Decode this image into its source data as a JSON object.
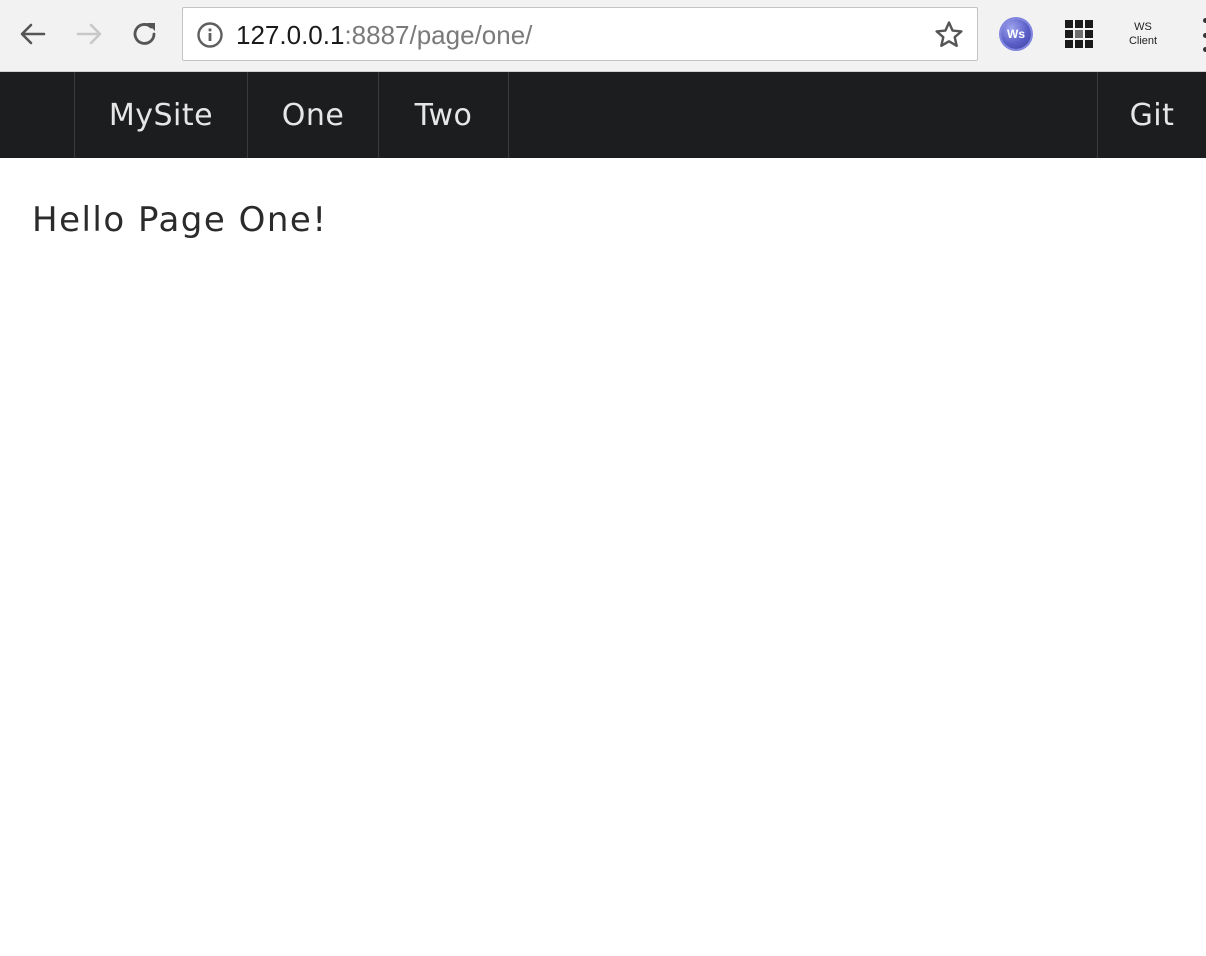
{
  "browser": {
    "url": {
      "host": "127.0.0.1",
      "rest": ":8887/page/one/"
    },
    "extensions": {
      "ws_badge_label": "Ws",
      "ws_client_line1": "WS",
      "ws_client_line2": "Client"
    }
  },
  "navbar": {
    "brand": "MySite",
    "links": [
      "One",
      "Two"
    ],
    "right_link": "Git"
  },
  "main": {
    "heading": "Hello Page One!"
  },
  "colors": {
    "navbar_bg": "#1c1d1f",
    "navbar_text": "#e6e6e6",
    "chrome_bg": "#f2f2f2"
  }
}
